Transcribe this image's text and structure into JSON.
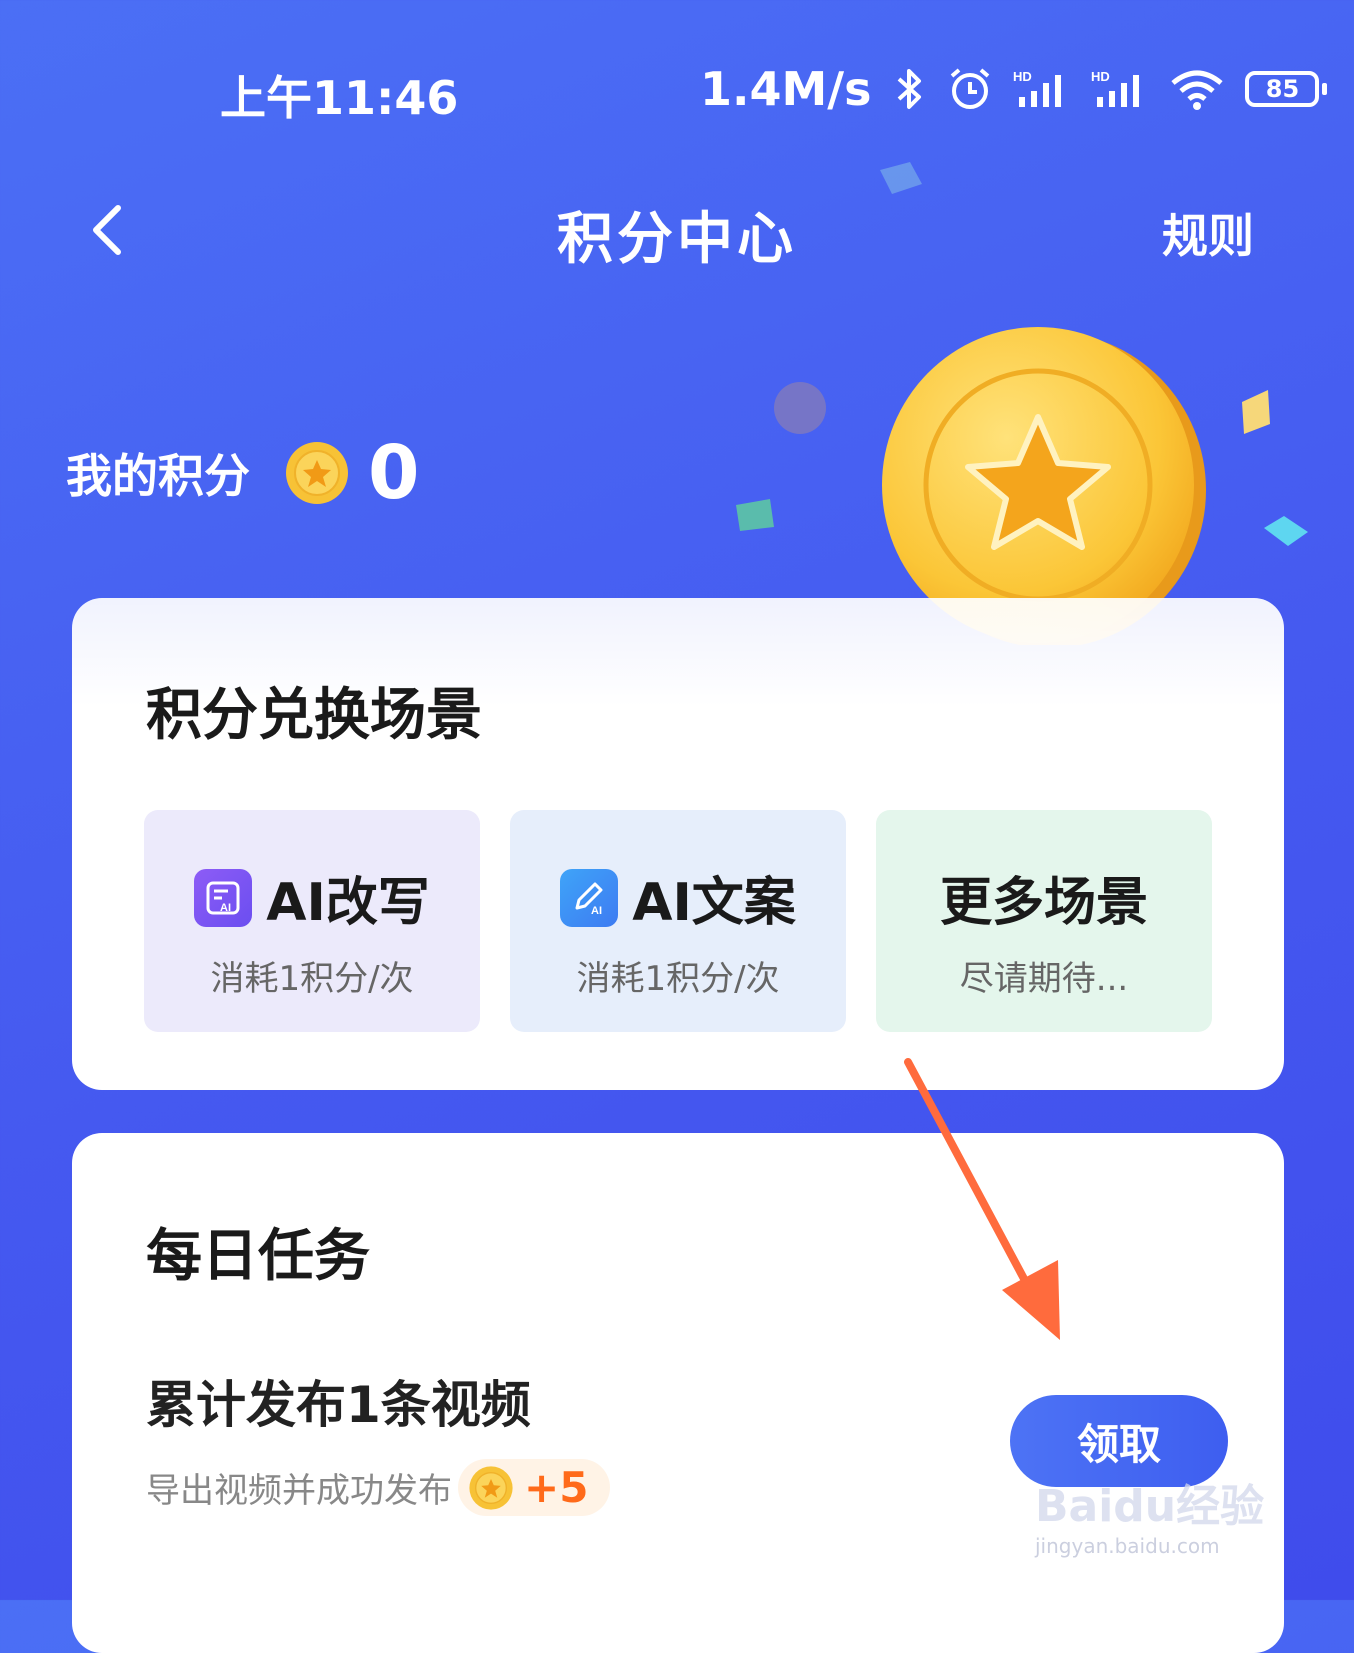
{
  "status_bar": {
    "time": "上午11:46",
    "network_speed": "1.4M/s",
    "battery": "85",
    "icons": [
      "bluetooth-icon",
      "alarm-icon",
      "hd-signal-icon",
      "hd-signal-icon",
      "wifi-icon",
      "battery-icon"
    ]
  },
  "nav": {
    "back_icon": "chevron-left-icon",
    "title": "积分中心",
    "rules": "规则"
  },
  "points": {
    "label": "我的积分",
    "value": "0",
    "icon": "coin-star-icon"
  },
  "exchange": {
    "title": "积分兑换场景",
    "scenes": [
      {
        "name": "AI改写",
        "sub": "消耗1积分/次",
        "icon": "ai-rewrite-icon",
        "color": "#7b54f3"
      },
      {
        "name": "AI文案",
        "sub": "消耗1积分/次",
        "icon": "ai-copywriting-icon",
        "color": "#3d8ff5"
      },
      {
        "name": "更多场景",
        "sub": "尽请期待..."
      }
    ]
  },
  "tasks": {
    "title": "每日任务",
    "items": [
      {
        "name": "累计发布1条视频",
        "desc": "导出视频并成功发布",
        "reward": "+5",
        "button": "领取"
      }
    ]
  },
  "watermark": {
    "brand": "Baidu经验",
    "url": "jingyan.baidu.com"
  },
  "colors": {
    "background": "#4559f0",
    "accent": "#4d73f5",
    "reward": "#ff6a1a",
    "annotation_arrow": "#ff6b3d"
  }
}
